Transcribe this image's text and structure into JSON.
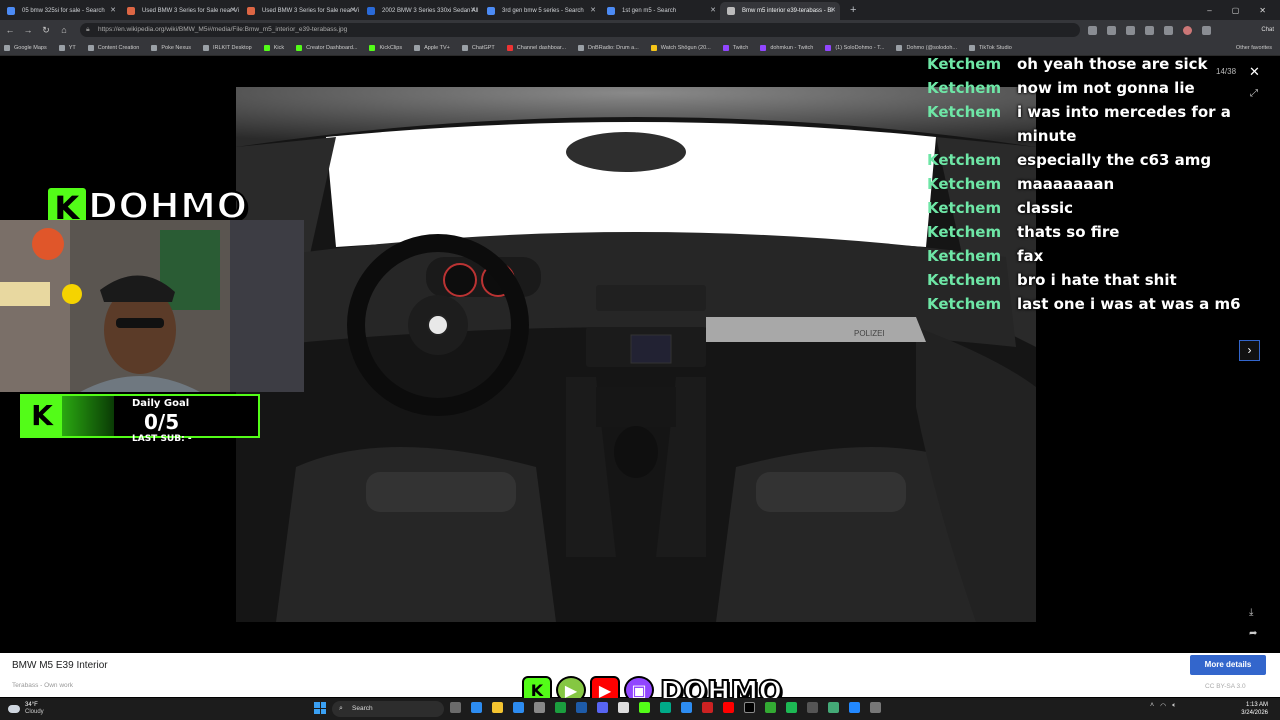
{
  "browser": {
    "tabs": [
      {
        "label": "05 bmw 325si for sale - Search",
        "active": false
      },
      {
        "label": "Used BMW 3 Series for Sale near Vi",
        "active": false
      },
      {
        "label": "Used BMW 3 Series for Sale near Vi",
        "active": false
      },
      {
        "label": "2002 BMW 3 Series 330xi Sedan All",
        "active": false
      },
      {
        "label": "3rd gen bmw 5 series - Search",
        "active": false
      },
      {
        "label": "1st gen m5 - Search",
        "active": false
      },
      {
        "label": "Bmw m5 interior e39-terabass - Bi",
        "active": true
      }
    ],
    "url": "https://en.wikipedia.org/wiki/BMW_M5#/media/File:Bmw_m5_interior_e39-terabass.jpg",
    "chat_button": "Chat",
    "bookmarks": [
      "Google Maps",
      "YT",
      "Content Creation",
      "Poke Nexus",
      "IRLKIT Desktop",
      "Kick",
      "Creator Dashboard...",
      "KickClips",
      "Apple TV+",
      "ChatGPT",
      "Channel dashboar...",
      "DnBRadio: Drum a...",
      "Watch Shōgun (20...",
      "Twitch",
      "dohmkun - Twitch",
      "(1) SoloDohmo - T...",
      "Dohmo (@solodoh...",
      "TikTok Studio"
    ],
    "other_favorites": "Other favorites"
  },
  "viewer": {
    "counter": "14/38",
    "caption": "BMW M5 E39 Interior",
    "author": "Terabass - Own work",
    "more_details": "More details",
    "license": "CC BY-SA 3.0",
    "dash_badge": "POLIZEI"
  },
  "stream": {
    "streamer_name": "DOHMO",
    "goal_title": "Daily Goal",
    "goal_count": "0/5",
    "goal_fraction": 0,
    "last_sub_label": "LAST SUB: -",
    "social_name": "DOHMO",
    "chat": [
      {
        "user": "Ketchem",
        "msg": "oh yeah those are sick"
      },
      {
        "user": "Ketchem",
        "msg": "now im not gonna lie"
      },
      {
        "user": "Ketchem",
        "msg": "i was into mercedes for a minute"
      },
      {
        "user": "Ketchem",
        "msg": "especially the c63 amg"
      },
      {
        "user": "Ketchem",
        "msg": "maaaaaaan"
      },
      {
        "user": "Ketchem",
        "msg": "classic"
      },
      {
        "user": "Ketchem",
        "msg": "thats so fire"
      },
      {
        "user": "Ketchem",
        "msg": "fax"
      },
      {
        "user": "Ketchem",
        "msg": "bro i hate that shit"
      },
      {
        "user": "Ketchem",
        "msg": "last one i was at was a m6"
      }
    ]
  },
  "taskbar": {
    "temp": "34°F",
    "condition": "Cloudy",
    "search_placeholder": "Search",
    "time": "1:13 AM",
    "date": "3/24/2026"
  },
  "colors": {
    "kick_green": "#53fc18",
    "chat_user": "#6ee6a6",
    "wiki_blue": "#3366cc"
  }
}
